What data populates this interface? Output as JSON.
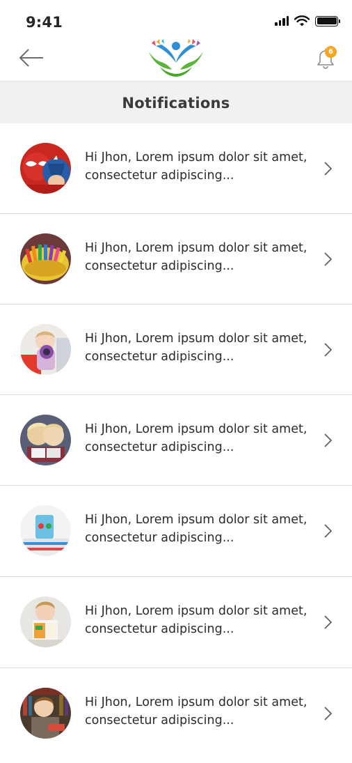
{
  "status_bar": {
    "time": "9:41"
  },
  "header": {
    "notification_count": "6"
  },
  "page": {
    "title": "Notifications"
  },
  "notifications": [
    {
      "text": "Hi Jhon, Lorem ipsum dolor sit amet, consectetur adipiscing...",
      "avatar": "superhero-kids-photo"
    },
    {
      "text": "Hi Jhon, Lorem ipsum dolor sit amet, consectetur adipiscing...",
      "avatar": "crayons-photo"
    },
    {
      "text": "Hi Jhon, Lorem ipsum dolor sit amet, consectetur adipiscing...",
      "avatar": "girl-with-camera-photo"
    },
    {
      "text": "Hi Jhon, Lorem ipsum dolor sit amet, consectetur adipiscing...",
      "avatar": "kids-reading-photo"
    },
    {
      "text": "Hi Jhon, Lorem ipsum dolor sit amet, consectetur adipiscing...",
      "avatar": "cup-on-books-photo"
    },
    {
      "text": "Hi Jhon, Lorem ipsum dolor sit amet, consectetur adipiscing...",
      "avatar": "toddler-with-book-photo"
    },
    {
      "text": "Hi Jhon, Lorem ipsum dolor sit amet, consectetur adipiscing...",
      "avatar": "boy-in-library-photo"
    }
  ],
  "colors": {
    "badge": "#f6a623",
    "title_bar_bg": "#f1f1f1",
    "logo_green": "#5cb53a",
    "logo_blue": "#2f8fd6"
  }
}
